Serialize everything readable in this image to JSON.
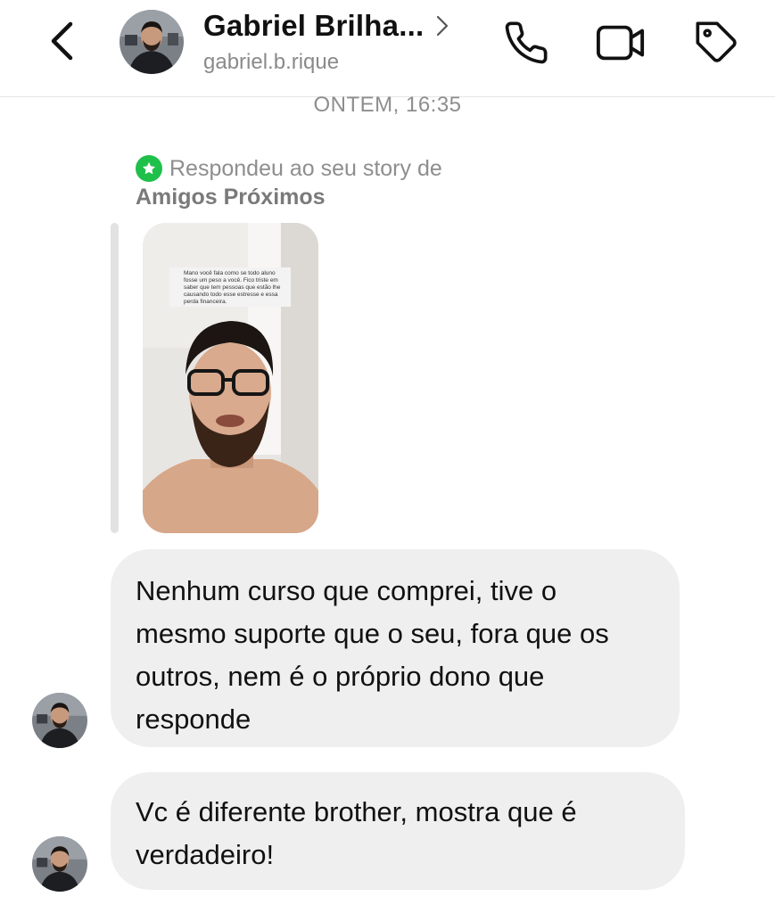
{
  "header": {
    "contact_name": "Gabriel Brilha...",
    "username": "gabriel.b.rique",
    "icons": [
      "chevron-left-icon",
      "chevron-right-icon",
      "phone-icon",
      "video-camera-icon",
      "tag-icon"
    ]
  },
  "chat": {
    "timestamp": "ONTEM, 16:35",
    "story_reply": {
      "label": "Respondeu ao seu story de",
      "audience": "Amigos Próximos",
      "badge_color": "#1ec04a",
      "sticker_text": "Mano você fala como se todo aluno fosse um peso a você. Fico triste em saber que tem pessoas que estão lhe causando todo esse estresse e essa perda financeira."
    },
    "messages": [
      {
        "text": "Nenhum curso que comprei, tive o mesmo suporte que o seu, fora que os outros, nem é o próprio dono que responde"
      },
      {
        "text": "Vc é diferente brother, mostra que é verdadeiro!"
      }
    ]
  },
  "colors": {
    "bubble_background": "#efefef",
    "secondary_text": "#8e8e8e"
  }
}
